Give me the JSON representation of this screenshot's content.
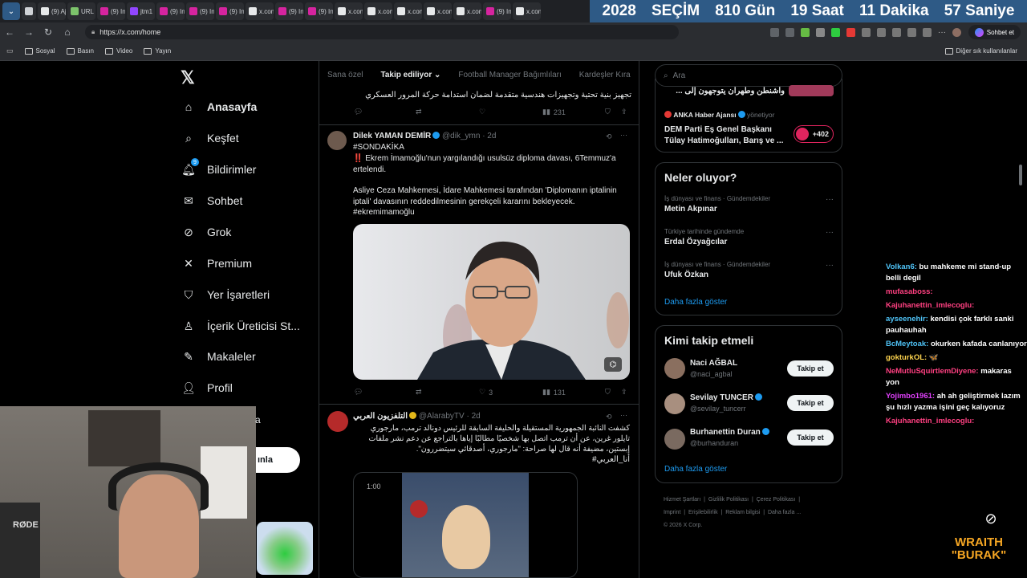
{
  "browser": {
    "tabs": [
      {
        "label": "",
        "color": "#cfd2d6"
      },
      {
        "label": "(9) Aj",
        "color": "#e7e9ea"
      },
      {
        "label": "URL",
        "color": "#7cc36b"
      },
      {
        "label": "(9) In",
        "color": "#d6249f"
      },
      {
        "label": "jtm1",
        "color": "#9146ff"
      },
      {
        "label": "(9) In",
        "color": "#d6249f"
      },
      {
        "label": "(9) In",
        "color": "#d6249f"
      },
      {
        "label": "(9) In",
        "color": "#d6249f"
      },
      {
        "label": "x.con",
        "color": "#e7e9ea"
      },
      {
        "label": "(9) In",
        "color": "#d6249f"
      },
      {
        "label": "(9) In",
        "color": "#d6249f"
      },
      {
        "label": "x.con",
        "color": "#e7e9ea"
      },
      {
        "label": "x.con",
        "color": "#e7e9ea"
      },
      {
        "label": "x.con",
        "color": "#e7e9ea"
      },
      {
        "label": "x.con",
        "color": "#e7e9ea"
      },
      {
        "label": "x.con",
        "color": "#e7e9ea"
      },
      {
        "label": "(9) In",
        "color": "#d6249f"
      },
      {
        "label": "x.con",
        "color": "#e7e9ea"
      }
    ],
    "url": "https://x.com/home",
    "chat_button": "Sohbet et",
    "bookmarks": [
      "Sosyal",
      "Basın",
      "Video",
      "Yayın"
    ],
    "other_bookmarks": "Diğer sık kullanılanlar"
  },
  "countdown": {
    "year": "2028",
    "label": "SEÇİM",
    "days": "810 Gün",
    "hours": "19 Saat",
    "minutes": "11 Dakika",
    "seconds": "57 Saniye"
  },
  "nav": {
    "items": [
      {
        "label": "Anasayfa",
        "icon": "home-icon"
      },
      {
        "label": "Keşfet",
        "icon": "search-icon"
      },
      {
        "label": "Bildirimler",
        "icon": "bell-icon"
      },
      {
        "label": "Sohbet",
        "icon": "mail-icon"
      },
      {
        "label": "Grok",
        "icon": "grok-icon"
      },
      {
        "label": "Premium",
        "icon": "x-icon"
      },
      {
        "label": "Yer İşaretleri",
        "icon": "bookmark-icon"
      },
      {
        "label": "İçerik Üreticisi St...",
        "icon": "creator-icon"
      },
      {
        "label": "Makaleler",
        "icon": "article-icon"
      },
      {
        "label": "Profil",
        "icon": "person-icon"
      }
    ],
    "notification_badge": "9",
    "post_button_partial": "ınla",
    "partial_item": "a"
  },
  "timeline": {
    "tabs": [
      "Sana özel",
      "Takip ediliyor",
      "Football Manager Bağımlıları",
      "Kardeşler Kıra"
    ],
    "post0": {
      "text": "تجهيز بنية تحتية وتجهيزات هندسية متقدمة لضمان استدامة حركة المرور العسكري",
      "views": "231"
    },
    "post1": {
      "name": "Dilek YAMAN DEMİR",
      "handle": "@dik_ymn · 2d",
      "hashtag": "#SONDAKİKA",
      "line1": "‼️ Ekrem İmamoğlu'nun yargılandığı usulsüz diploma davası, 6Temmuz'a ertelendi.",
      "line2": "Asliye Ceza Mahkemesi, İdare Mahkemesi tarafından 'Diplomanın iptalinin iptali' davasının reddedilmesinin gerekçeli kararını bekleyecek.",
      "hashtag2": "#ekremimamoğlu",
      "likes": "3",
      "views": "131"
    },
    "post2": {
      "name": "التلفزيون العربي",
      "handle": "@AlarabyTV · 2d",
      "text": "كشفت النائبة الجمهورية المستقيلة والحليفة السابقة للرئيس دونالد ترمب، مارجوري تايلور غرين، عن أن ترمب اتصل بها شخصيًا مطالبًا إياها بالتراجع عن دعم نشر ملفات إبستين، مضيفة أنه قال لها صراحة: \"مارجوري، أصدقائي سيتضررون\".",
      "hashtag": "#أنا_العربي",
      "video_time": "1:00"
    }
  },
  "right": {
    "search_placeholder": "Ara",
    "top_card": {
      "item1": "واشنطن وطهران يتوجهون إلى ...",
      "source": "ANKA Haber Ajansı",
      "source_suffix": "yönetiyor",
      "headline": "DEM Parti Eş Genel Başkanı Tülay Hatimoğulları, Barış ve ...",
      "count": "+402"
    },
    "trends_title": "Neler oluyor?",
    "trends": [
      {
        "category": "İş dünyası ve finans · Gündemdekiler",
        "name": "Metin Akpınar"
      },
      {
        "category": "Türkiye tarihinde gündemde",
        "name": "Erdal Özyağcılar"
      },
      {
        "category": "İş dünyası ve finans · Gündemdekiler",
        "name": "Ufuk Özkan"
      }
    ],
    "show_more": "Daha fazla göster",
    "who_title": "Kimi takip etmeli",
    "who": [
      {
        "name": "Naci AĞBAL",
        "handle": "@naci_agbal",
        "verified": false
      },
      {
        "name": "Sevilay TUNCER",
        "handle": "@sevilay_tuncerr",
        "verified": true
      },
      {
        "name": "Burhanettin Duran",
        "handle": "@burhanduran",
        "verified": true
      }
    ],
    "follow_label": "Takip et",
    "footer": [
      "Hizmet Şartları",
      "Gizlilik Politikası",
      "Çerez Politikası",
      "Imprint",
      "Erişilebilirlik",
      "Reklam bilgisi",
      "Daha fazla ...",
      "© 2026 X Corp."
    ]
  },
  "chat": [
    {
      "user": "Volkan6:",
      "text": "bu mahkeme mi stand-up belli degil",
      "color": "#4fc3f7"
    },
    {
      "user": "mufasaboss:",
      "text": "",
      "color": "#ff4081"
    },
    {
      "user": "Kajuhanettin_imlecoglu:",
      "text": "",
      "color": "#ff4081"
    },
    {
      "user": "ayseenehir:",
      "text": "kendisi çok farklı sanki pauhauhah",
      "color": "#4fc3f7"
    },
    {
      "user": "BcMeytoak:",
      "text": "okurken kafada canlanıyor",
      "color": "#4fc3f7"
    },
    {
      "user": "gokturkOL:",
      "text": "🦋",
      "color": "#ffd54f"
    },
    {
      "user": "NeMutluSquirtlemDiyene:",
      "text": "makaras yon",
      "color": "#ff4081"
    },
    {
      "user": "Yojimbo1961:",
      "text": "ah ah geliştirmek lazım şu hızlı yazma işini geç kalıyoruz",
      "color": "#e040fb"
    },
    {
      "user": "Kajuhanettin_imlecoglu:",
      "text": "",
      "color": "#ff4081"
    }
  ],
  "overlay": {
    "brand_line1": "WRAITH",
    "brand_line2": "\"BURAK\"",
    "mic_brand": "RØDE"
  }
}
